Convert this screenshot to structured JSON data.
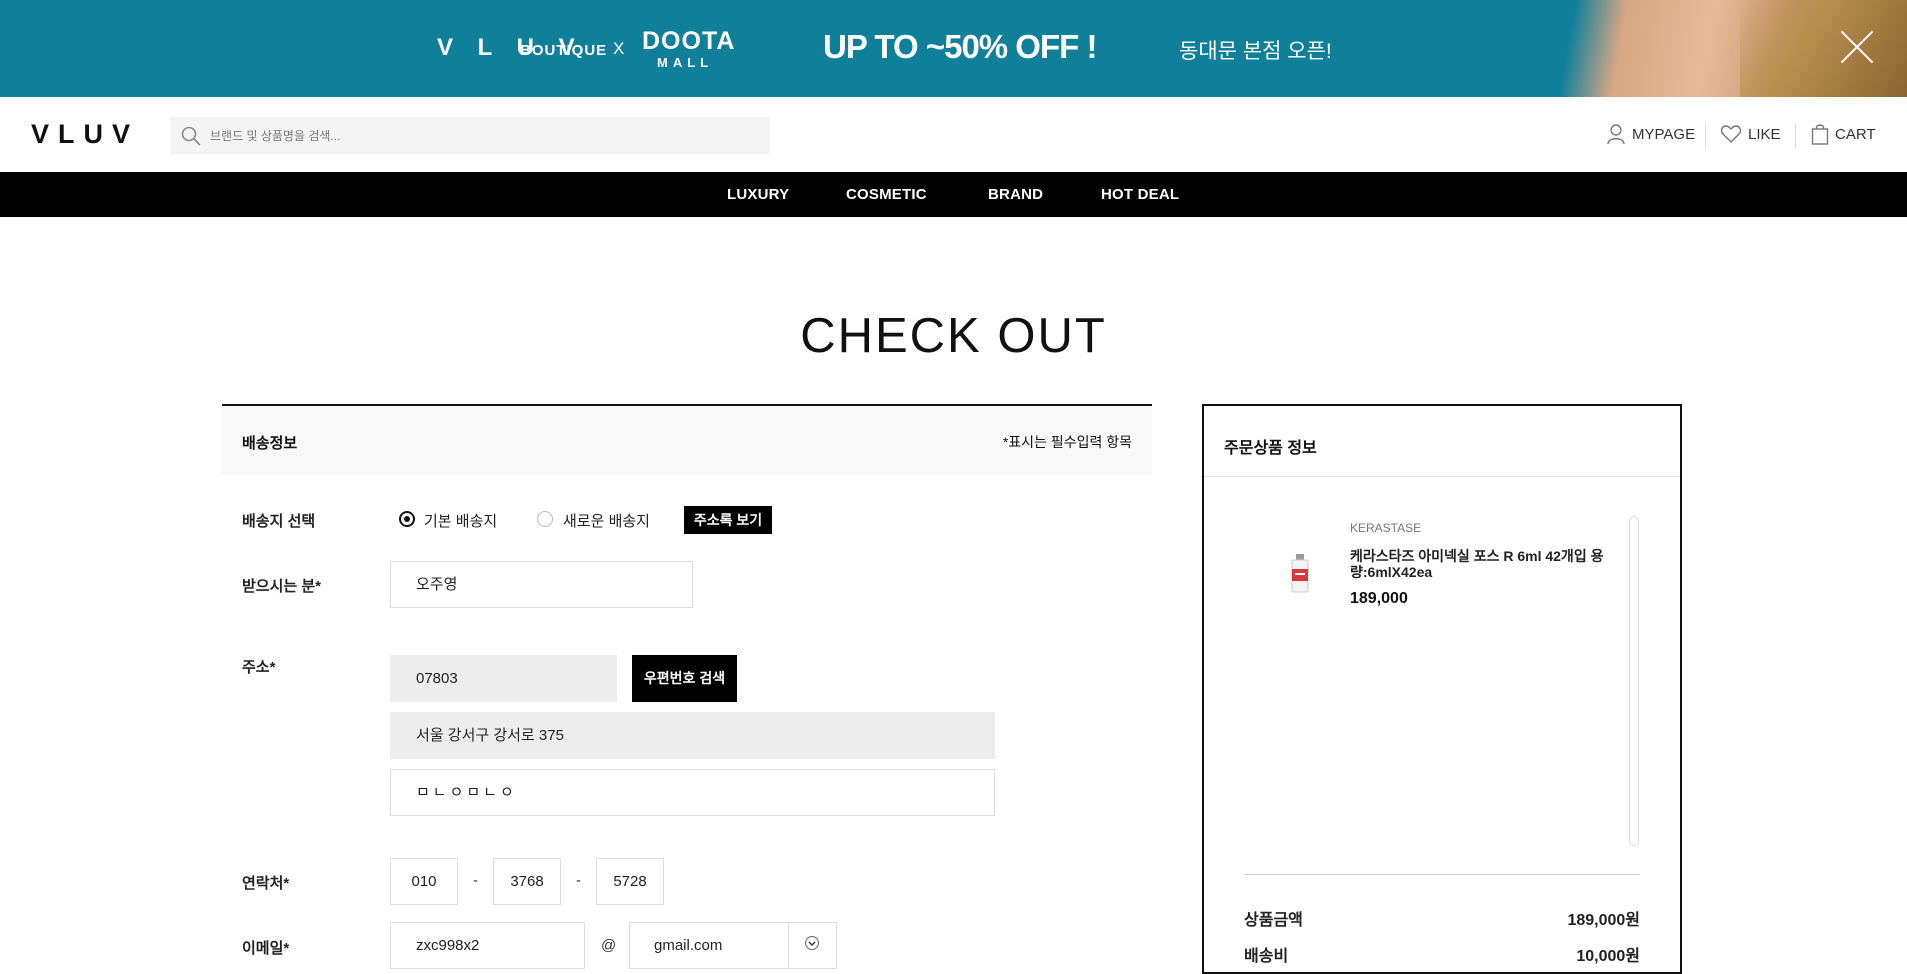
{
  "promo": {
    "brand": "V L U V",
    "brand_sub": "BOUTIQUE",
    "x": "X",
    "partner_top": "DOOTA",
    "partner_bottom": "MALL",
    "sale": "UP TO ~50% OFF !",
    "open": "동대문 본점 오픈!"
  },
  "header": {
    "logo": "VLUV",
    "search_placeholder": "브랜드 및 상품명을 검색...",
    "mypage": "MYPAGE",
    "like": "LIKE",
    "cart": "CART"
  },
  "nav": {
    "items": [
      "LUXURY",
      "COSMETIC",
      "BRAND",
      "HOT DEAL"
    ]
  },
  "page_title": "CHECK OUT",
  "shipping": {
    "title": "배송정보",
    "required_note": "*표시는 필수입력 항목",
    "dest_label": "배송지 선택",
    "dest_default": "기본 배송지",
    "dest_new": "새로운 배송지",
    "address_book": "주소록 보기",
    "recipient_label": "받으시는 분*",
    "recipient": "오주영",
    "address_label": "주소*",
    "zipcode": "07803",
    "zip_search": "우편번호 검색",
    "address1": "서울 강서구 강서로 375",
    "address2": "ㅁㄴㅇㅁㄴㅇ",
    "phone_label": "연락처*",
    "phone1": "010",
    "phone2": "3768",
    "phone3": "5728",
    "phone_sep": "-",
    "email_label": "이메일*",
    "email_id": "zxc998x2",
    "at": "@",
    "email_domain": "gmail.com"
  },
  "summary": {
    "title": "주문상품 정보",
    "product": {
      "brand": "KERASTASE",
      "name": "케라스타즈 아미넥실 포스 R 6ml 42개입 용량:6mlX42ea",
      "price": "189,000"
    },
    "rows": [
      {
        "label": "상품금액",
        "value": "189,000원"
      },
      {
        "label": "배송비",
        "value": "10,000원"
      }
    ]
  }
}
